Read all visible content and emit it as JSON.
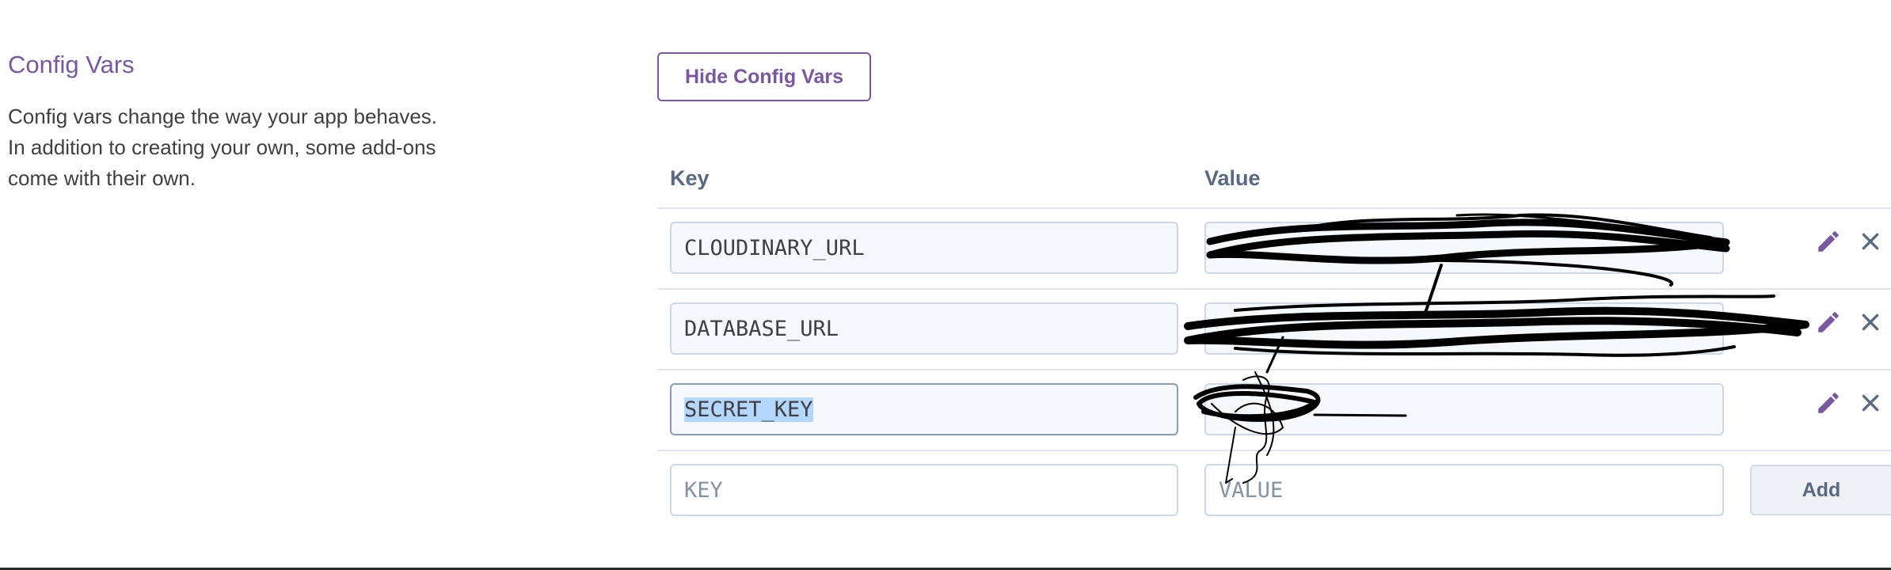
{
  "section": {
    "title": "Config Vars",
    "description": "Config vars change the way your app behaves. In addition to creating your own, some add-ons come with their own."
  },
  "hide_button": {
    "label": "Hide Config Vars"
  },
  "table": {
    "key_header": "Key",
    "value_header": "Value",
    "rows": [
      {
        "key": "CLOUDINARY_URL",
        "value": ""
      },
      {
        "key": "DATABASE_URL",
        "value": ""
      },
      {
        "key": "SECRET_KEY",
        "value": ""
      }
    ],
    "new_row": {
      "key_placeholder": "KEY",
      "value_placeholder": "VALUE",
      "add_label": "Add"
    }
  },
  "icons": {
    "edit": "pencil-icon",
    "delete": "close-icon"
  },
  "colors": {
    "accent": "#79589f",
    "header": "#596981",
    "selection": "#b4d7ff"
  }
}
